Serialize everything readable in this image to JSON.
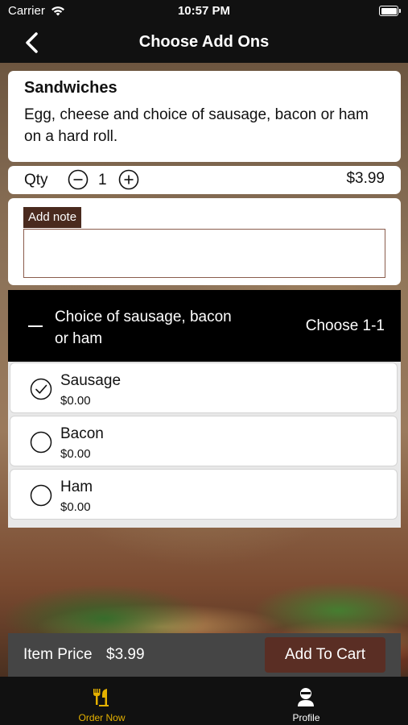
{
  "status_bar": {
    "carrier": "Carrier",
    "time": "10:57 PM"
  },
  "nav": {
    "title": "Choose Add Ons",
    "back_icon": "chevron-left-icon"
  },
  "item": {
    "category": "Sandwiches",
    "description": "Egg, cheese and choice of sausage, bacon or ham on a  hard roll."
  },
  "quantity": {
    "label": "Qty",
    "value": "1",
    "price": "$3.99"
  },
  "note": {
    "label": "Add note",
    "value": ""
  },
  "addon_group": {
    "title": "Choice of sausage, bacon or ham",
    "rule": "Choose 1-1",
    "options": [
      {
        "name": "Sausage",
        "price": "$0.00",
        "selected": true
      },
      {
        "name": "Bacon",
        "price": "$0.00",
        "selected": false
      },
      {
        "name": "Ham",
        "price": "$0.00",
        "selected": false
      }
    ]
  },
  "footer": {
    "price_label": "Item Price",
    "price_value": "$3.99",
    "add_to_cart": "Add To Cart"
  },
  "tabs": [
    {
      "label": "Order Now",
      "icon": "fork-knife-icon",
      "active": true
    },
    {
      "label": "Profile",
      "icon": "user-icon",
      "active": false
    }
  ],
  "colors": {
    "accent": "#e5b100",
    "brand_brown": "#5a2e24",
    "note_label_bg": "#4a2a1e",
    "nav_bg": "#111111"
  }
}
